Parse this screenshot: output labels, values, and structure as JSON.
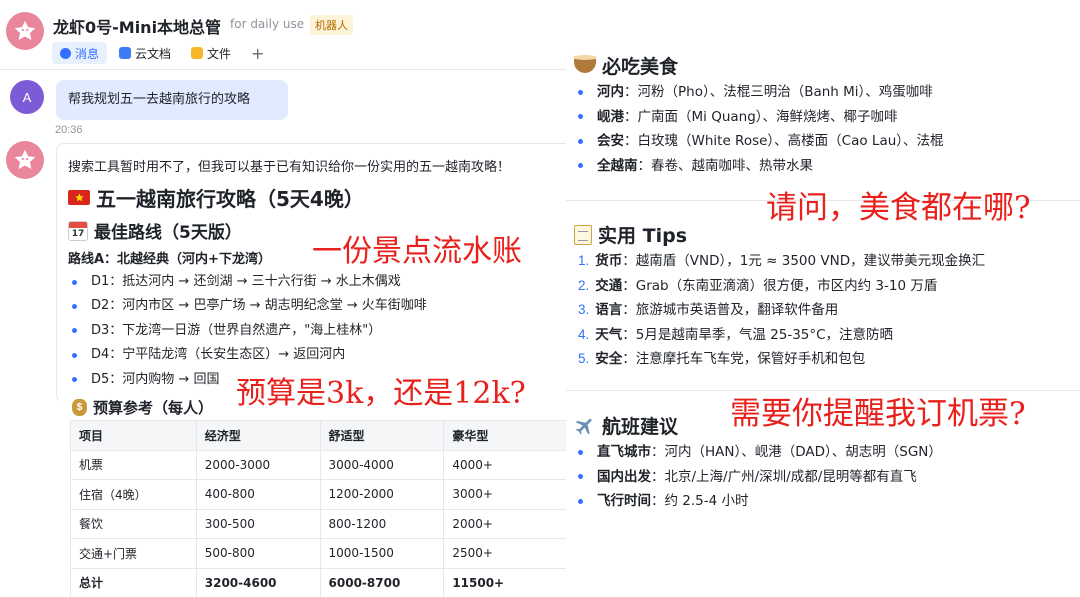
{
  "chat": {
    "title": "龙虾0号-Mini本地总管",
    "subtitle": "for daily use",
    "tag": "机器人",
    "tabs": [
      {
        "label": "消息",
        "icon": "message-icon"
      },
      {
        "label": "云文档",
        "icon": "doc-icon"
      },
      {
        "label": "文件",
        "icon": "folder-icon"
      }
    ],
    "add_tab": "+",
    "user_avatar_letter": "A",
    "user_message": "帮我规划五一去越南旅行的攻略",
    "time": "20:36",
    "reply": {
      "intro": "搜索工具暂时用不了，但我可以基于已有知识给你一份实用的五一越南攻略！",
      "title": "五一越南旅行攻略（5天4晚）",
      "route_heading": "最佳路线（5天版）",
      "calendar_day": "17",
      "route_label": "路线A：北越经典（河内+下龙湾）",
      "days": [
        "D1：抵达河内 → 还剑湖 → 三十六行街 → 水上木偶戏",
        "D2：河内市区 → 巴亭广场 → 胡志明纪念堂 → 火车街咖啡",
        "D3：下龙湾一日游（世界自然遗产，\"海上桂林\"）",
        "D4：宁平陆龙湾（长安生态区）→ 返回河内",
        "D5：河内购物 → 回国"
      ]
    }
  },
  "budget": {
    "title": "预算参考（每人）",
    "headers": [
      "项目",
      "经济型",
      "舒适型",
      "豪华型"
    ],
    "rows": [
      [
        "机票",
        "2000-3000",
        "3000-4000",
        "4000+"
      ],
      [
        "住宿（4晚）",
        "400-800",
        "1200-2000",
        "3000+"
      ],
      [
        "餐饮",
        "300-500",
        "800-1200",
        "2000+"
      ],
      [
        "交通+门票",
        "500-800",
        "1000-1500",
        "2500+"
      ],
      [
        "总计",
        "3200-4600",
        "6000-8700",
        "11500+"
      ]
    ]
  },
  "food": {
    "title": "必吃美食",
    "items": [
      {
        "key": "河内",
        "text": "：河粉（Pho）、法棍三明治（Banh Mi）、鸡蛋咖啡"
      },
      {
        "key": "岘港",
        "text": "：广南面（Mi Quang）、海鲜烧烤、椰子咖啡"
      },
      {
        "key": "会安",
        "text": "：白玫瑰（White Rose）、高楼面（Cao Lau）、法棍"
      },
      {
        "key": "全越南",
        "text": "：春卷、越南咖啡、热带水果"
      }
    ]
  },
  "tips": {
    "title": "实用 Tips",
    "items": [
      {
        "num": "1.",
        "key": "货币",
        "text": "：越南盾（VND），1元 ≈ 3500 VND，建议带美元现金换汇"
      },
      {
        "num": "2.",
        "key": "交通",
        "text": "：Grab（东南亚滴滴）很方便，市区内约 3-10 万盾"
      },
      {
        "num": "3.",
        "key": "语言",
        "text": "：旅游城市英语普及，翻译软件备用"
      },
      {
        "num": "4.",
        "key": "天气",
        "text": "：5月是越南旱季，气温 25-35°C，注意防晒"
      },
      {
        "num": "5.",
        "key": "安全",
        "text": "：注意摩托车飞车党，保管好手机和包包"
      }
    ]
  },
  "flights": {
    "title": "航班建议",
    "items": [
      {
        "key": "直飞城市",
        "text": "：河内（HAN）、岘港（DAD）、胡志明（SGN）"
      },
      {
        "key": "国内出发",
        "text": "：北京/上海/广州/深圳/成都/昆明等都有直飞"
      },
      {
        "key": "飞行时间",
        "text": "：约 2.5-4 小时"
      }
    ]
  },
  "annotations": {
    "itinerary": "一份景点流水账",
    "budget": "预算是3k，还是12k?",
    "food": "请问，美食都在哪?",
    "flights": "需要你提醒我订机票?"
  },
  "colors": {
    "accent": "#3370ff",
    "annotation": "#e8211c",
    "user_bubble": "#e1eaff",
    "bot_avatar": "#e9869b"
  }
}
